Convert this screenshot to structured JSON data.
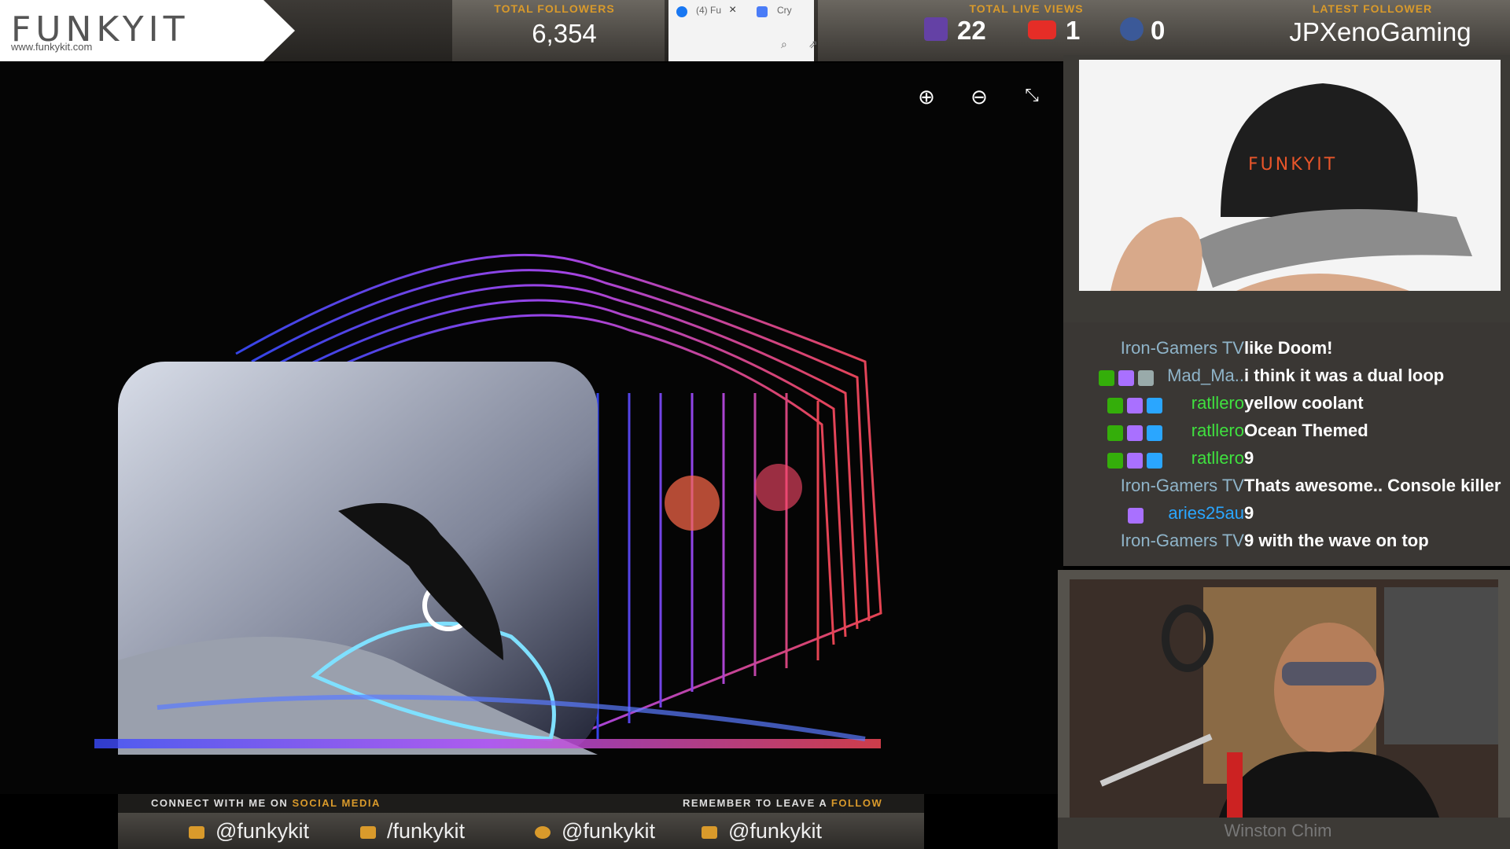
{
  "brand": {
    "logo": "FUNKYIT",
    "url": "www.funkykit.com"
  },
  "stats": {
    "total_followers_label": "TOTAL FOLLOWERS",
    "total_followers_value": "6,354",
    "total_live_views_label": "TOTAL LIVE VIEWS",
    "twitch_views": "22",
    "youtube_views": "1",
    "facebook_views": "0",
    "latest_follower_label": "LATEST FOLLOWER",
    "latest_follower_value": "JPXenoGaming"
  },
  "browser_tabs": [
    {
      "label": "(4) Fu",
      "close": "×"
    },
    {
      "label": "Cry"
    }
  ],
  "viewer_controls": {
    "zoom_in": "zoom-in-icon",
    "zoom_out": "zoom-out-icon",
    "collapse": "collapse-icon"
  },
  "social": {
    "caption_left_prefix": "CONNECT WITH ME ON",
    "caption_left_highlight": "SOCIAL MEDIA",
    "caption_right_prefix": "REMEMBER TO LEAVE A",
    "caption_right_highlight": "FOLLOW",
    "handles": [
      {
        "platform": "twitch",
        "text": "@funkykit",
        "color": "#d99a2b"
      },
      {
        "platform": "youtube",
        "text": "/funkykit",
        "color": "#d99a2b"
      },
      {
        "platform": "twitter",
        "text": "@funkykit",
        "color": "#d99a2b"
      },
      {
        "platform": "facebook",
        "text": "@funkykit",
        "color": "#d99a2b"
      }
    ]
  },
  "chat": {
    "messages": [
      {
        "user": "Iron-Gamers TV",
        "text": "like Doom!",
        "color": "#8fb4c9",
        "badges": []
      },
      {
        "user": "Mad_Ma..",
        "text": "i think it was a dual loop",
        "color": "#8fb4c9",
        "badges": [
          "mod",
          "vip",
          "prime"
        ]
      },
      {
        "user": "ratllero",
        "text": "yellow coolant",
        "color": "#3fe03f",
        "badges": [
          "mod",
          "sub",
          "prime"
        ]
      },
      {
        "user": "ratllero",
        "text": "Ocean Themed",
        "color": "#3fe03f",
        "badges": [
          "mod",
          "sub",
          "prime"
        ]
      },
      {
        "user": "ratllero",
        "text": "9",
        "color": "#3fe03f",
        "badges": [
          "mod",
          "sub",
          "prime"
        ]
      },
      {
        "user": "Iron-Gamers TV",
        "text": "Thats awesome.. Console killer",
        "color": "#8fb4c9",
        "badges": []
      },
      {
        "user": "aries25au",
        "text": "9",
        "color": "#2aa6ff",
        "badges": [
          "vip"
        ]
      },
      {
        "user": "Iron-Gamers TV",
        "text": "9 with the wave on top",
        "color": "#8fb4c9",
        "badges": []
      }
    ]
  },
  "webcam": {
    "name_plate": "Winston Chim"
  },
  "colors": {
    "accent": "#d99a2b",
    "panel": "#3a3734"
  }
}
